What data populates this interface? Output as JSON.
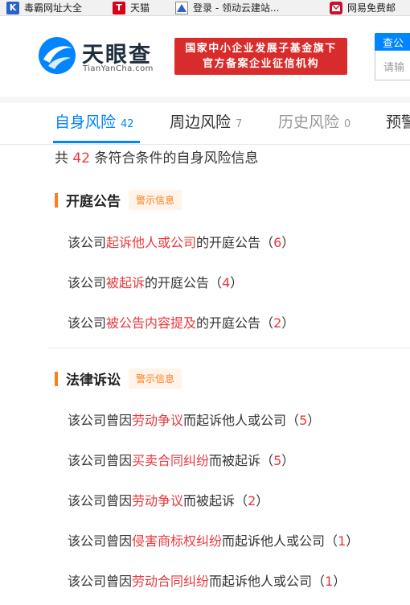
{
  "bookmarks": [
    {
      "icon": "k-logo-icon",
      "label": "毒霸网址大全"
    },
    {
      "icon": "tmall-icon",
      "label": "天猫"
    },
    {
      "icon": "bookmark-page-icon",
      "label": "登录 - 领动云建站..."
    },
    {
      "icon": "netease-mail-icon",
      "label": "网易免费邮"
    }
  ],
  "header": {
    "logo_text": "天眼查",
    "logo_sub": "TianYanCha.com",
    "slogan_line1": "国家中小企业发展子基金旗下",
    "slogan_line2": "官方备案企业征信机构",
    "search_tab": "查公",
    "search_placeholder": "请输"
  },
  "tabs": [
    {
      "label": "自身风险",
      "count": "42",
      "state": "active"
    },
    {
      "label": "周边风险",
      "count": "7",
      "state": "normal"
    },
    {
      "label": "历史风险",
      "count": "0",
      "state": "disabled"
    },
    {
      "label": "预警",
      "count": "",
      "state": "normal"
    }
  ],
  "summary": {
    "prefix": "共 ",
    "count": "42",
    "suffix": " 条符合条件的自身风险信息"
  },
  "sections": [
    {
      "title": "开庭公告",
      "badge": "警示信息",
      "items": [
        {
          "pre": "该公司",
          "hl": "起诉他人或公司",
          "post": "的开庭公告",
          "count": "6"
        },
        {
          "pre": "该公司",
          "hl": "被起诉",
          "post": "的开庭公告",
          "count": "4"
        },
        {
          "pre": "该公司",
          "hl": "被公告内容提及",
          "post": "的开庭公告",
          "count": "2"
        }
      ]
    },
    {
      "title": "法律诉讼",
      "badge": "警示信息",
      "items": [
        {
          "pre": "该公司曾因",
          "hl": "劳动争议",
          "post": "而起诉他人或公司",
          "count": "5"
        },
        {
          "pre": "该公司曾因",
          "hl": "买卖合同纠纷",
          "post": "而被起诉",
          "count": "5"
        },
        {
          "pre": "该公司曾因",
          "hl": "劳动争议",
          "post": "而被起诉",
          "count": "2"
        },
        {
          "pre": "该公司曾因",
          "hl": "侵害商标权纠纷",
          "post": "而起诉他人或公司",
          "count": "1"
        },
        {
          "pre": "该公司曾因",
          "hl": "劳动合同纠纷",
          "post": "而起诉他人或公司",
          "count": "1"
        }
      ]
    }
  ],
  "colors": {
    "accent": "#0084ff",
    "highlight": "#e8383d",
    "warning": "#ff7d1a",
    "slogan_bg": "#d82c2c"
  }
}
